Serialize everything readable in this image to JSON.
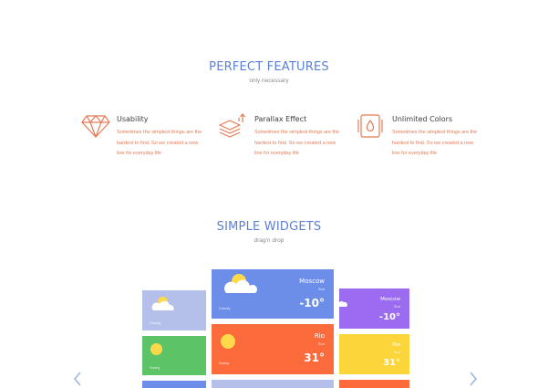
{
  "features_section": {
    "title": "PERFECT FEATURES",
    "subtitle": "only necessary",
    "items": [
      {
        "title": "Usability",
        "icon": "diamond-icon",
        "description": "Sometimes the simplest things are the hardest to find. So we created a new line for everyday life"
      },
      {
        "title": "Parallax Effect",
        "icon": "layers-icon",
        "description": "Sometimes the simplest things are the hardest to find. So we created a new line for everyday life"
      },
      {
        "title": "Unlimited Colors",
        "icon": "color-drop-icon",
        "description": "Sometimes the simplest things are the hardest to find. So we created a new line for everyday life"
      }
    ]
  },
  "widgets_section": {
    "title": "SIMPLE WIDGETS",
    "subtitle": "drag'n drop",
    "prev_icon": "chevron-left-icon",
    "next_icon": "chevron-right-icon",
    "widgets": {
      "moscow_main": {
        "city": "Moscow",
        "sub": "Sun",
        "temp": "-10",
        "cond": "Cloudy",
        "color": "#6d8ee8"
      },
      "rio_main": {
        "city": "Rio",
        "sub": "Sun",
        "temp": "31",
        "cond": "Sunny",
        "color": "#fb6b3c"
      },
      "moscow_small": {
        "city": "Moscow",
        "sub": "Sun",
        "temp": "-10",
        "color": "#9c6cf0"
      },
      "rio_small": {
        "city": "Rio",
        "sub": "Sun",
        "temp": "31",
        "color": "#fcd53a"
      },
      "left_top": {
        "cond": "Cloudy",
        "color": "#b4c0ea"
      },
      "left_mid": {
        "cond": "Sunny",
        "color": "#5cc466"
      }
    }
  },
  "colors": {
    "accent_blue": "#5b7fd6",
    "accent_orange": "#e57a56"
  }
}
